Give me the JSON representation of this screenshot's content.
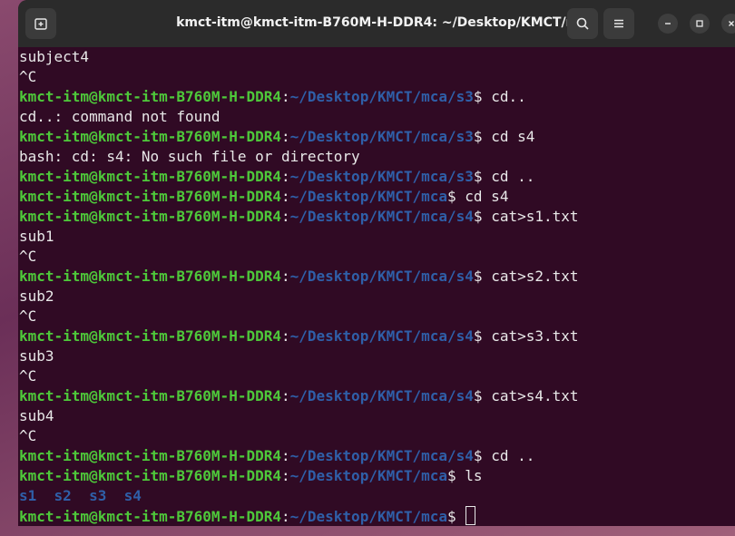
{
  "window": {
    "title": "kmct-itm@kmct-itm-B760M-H-DDR4: ~/Desktop/KMCT/mca"
  },
  "icons": {
    "new_tab": "new-tab-icon",
    "search": "search-icon",
    "menu": "hamburger-menu-icon",
    "minimize": "minimize-icon",
    "maximize": "maximize-icon",
    "close": "close-icon"
  },
  "colors": {
    "terminal_bg": "#300a24",
    "user_host": "#4ec93a",
    "path": "#2f5fa8",
    "text": "#e8e8e8"
  },
  "terminal": {
    "user": "kmct-itm@kmct-itm-B760M-H-DDR4",
    "lines": [
      {
        "type": "out",
        "text": "subject4"
      },
      {
        "type": "out",
        "text": "^C"
      },
      {
        "type": "prompt",
        "path": "~/Desktop/KMCT/mca/s3",
        "cmd": "cd.."
      },
      {
        "type": "out",
        "text": "cd..: command not found"
      },
      {
        "type": "prompt",
        "path": "~/Desktop/KMCT/mca/s3",
        "cmd": "cd s4"
      },
      {
        "type": "out",
        "text": "bash: cd: s4: No such file or directory"
      },
      {
        "type": "prompt",
        "path": "~/Desktop/KMCT/mca/s3",
        "cmd": "cd .."
      },
      {
        "type": "prompt",
        "path": "~/Desktop/KMCT/mca",
        "cmd": "cd s4"
      },
      {
        "type": "prompt",
        "path": "~/Desktop/KMCT/mca/s4",
        "cmd": "cat>s1.txt"
      },
      {
        "type": "out",
        "text": "sub1"
      },
      {
        "type": "out",
        "text": "^C"
      },
      {
        "type": "prompt",
        "path": "~/Desktop/KMCT/mca/s4",
        "cmd": "cat>s2.txt"
      },
      {
        "type": "out",
        "text": "sub2"
      },
      {
        "type": "out",
        "text": "^C"
      },
      {
        "type": "prompt",
        "path": "~/Desktop/KMCT/mca/s4",
        "cmd": "cat>s3.txt"
      },
      {
        "type": "out",
        "text": "sub3"
      },
      {
        "type": "out",
        "text": "^C"
      },
      {
        "type": "prompt",
        "path": "~/Desktop/KMCT/mca/s4",
        "cmd": "cat>s4.txt"
      },
      {
        "type": "out",
        "text": "sub4"
      },
      {
        "type": "out",
        "text": "^C"
      },
      {
        "type": "prompt",
        "path": "~/Desktop/KMCT/mca/s4",
        "cmd": "cd .."
      },
      {
        "type": "prompt",
        "path": "~/Desktop/KMCT/mca",
        "cmd": "ls"
      },
      {
        "type": "ls",
        "text": "s1  s2  s3  s4"
      },
      {
        "type": "current",
        "path": "~/Desktop/KMCT/mca",
        "cmd": ""
      }
    ]
  }
}
